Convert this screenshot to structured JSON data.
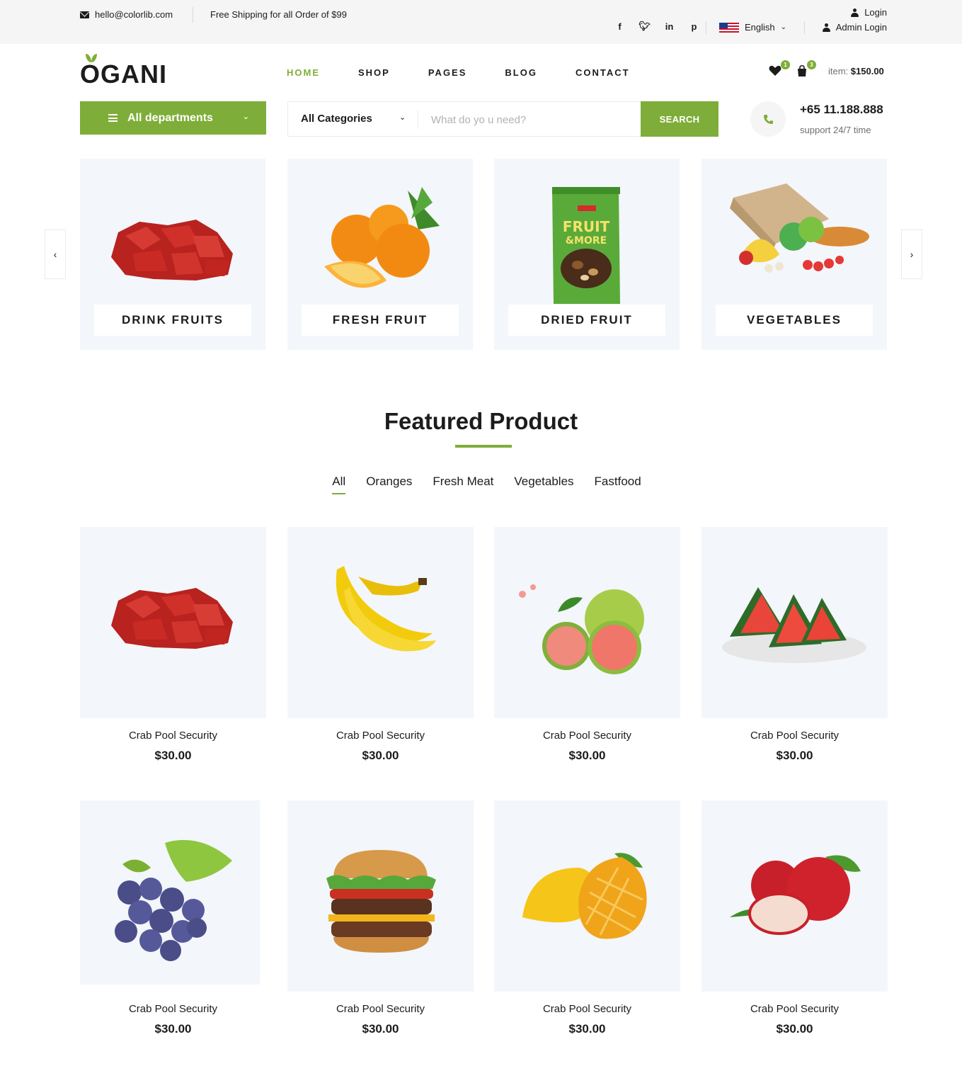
{
  "topbar": {
    "email": "hello@colorlib.com",
    "shipping": "Free Shipping for all Order of $99",
    "socials": [
      "f",
      "t",
      "in",
      "p"
    ],
    "language": "English",
    "login": "Login",
    "admin_login": "Admin Login"
  },
  "header": {
    "logo": "OGANI",
    "nav": [
      "HOME",
      "SHOP",
      "PAGES",
      "BLOG",
      "CONTACT"
    ],
    "wishlist_count": "1",
    "cart_count": "3",
    "item_label": "item:",
    "item_total": "$150.00"
  },
  "search": {
    "departments": "All departments",
    "category": "All Categories",
    "placeholder": "What do yo u need?",
    "button": "SEARCH",
    "phone": "+65 11.188.888",
    "support": "support 24/7 time"
  },
  "categories": [
    {
      "label": "DRINK FRUITS",
      "icon": "meat"
    },
    {
      "label": "FRESH FRUIT",
      "icon": "oranges"
    },
    {
      "label": "DRIED FRUIT",
      "icon": "fruit-nuts-bag"
    },
    {
      "label": "VEGETABLES",
      "icon": "vegetable-bag"
    }
  ],
  "featured": {
    "title": "Featured Product",
    "filters": [
      "All",
      "Oranges",
      "Fresh Meat",
      "Vegetables",
      "Fastfood"
    ],
    "products": [
      {
        "name": "Crab Pool Security",
        "price": "$30.00",
        "icon": "meat"
      },
      {
        "name": "Crab Pool Security",
        "price": "$30.00",
        "icon": "banana"
      },
      {
        "name": "Crab Pool Security",
        "price": "$30.00",
        "icon": "guava"
      },
      {
        "name": "Crab Pool Security",
        "price": "$30.00",
        "icon": "watermelon"
      },
      {
        "name": "Crab Pool Security",
        "price": "$30.00",
        "icon": "grapes"
      },
      {
        "name": "Crab Pool Security",
        "price": "$30.00",
        "icon": "burger"
      },
      {
        "name": "Crab Pool Security",
        "price": "$30.00",
        "icon": "mango"
      },
      {
        "name": "Crab Pool Security",
        "price": "$30.00",
        "icon": "apple"
      }
    ]
  },
  "colors": {
    "accent": "#7fad39",
    "card_bg": "#f3f6fa",
    "topbar_bg": "#f5f5f5"
  }
}
